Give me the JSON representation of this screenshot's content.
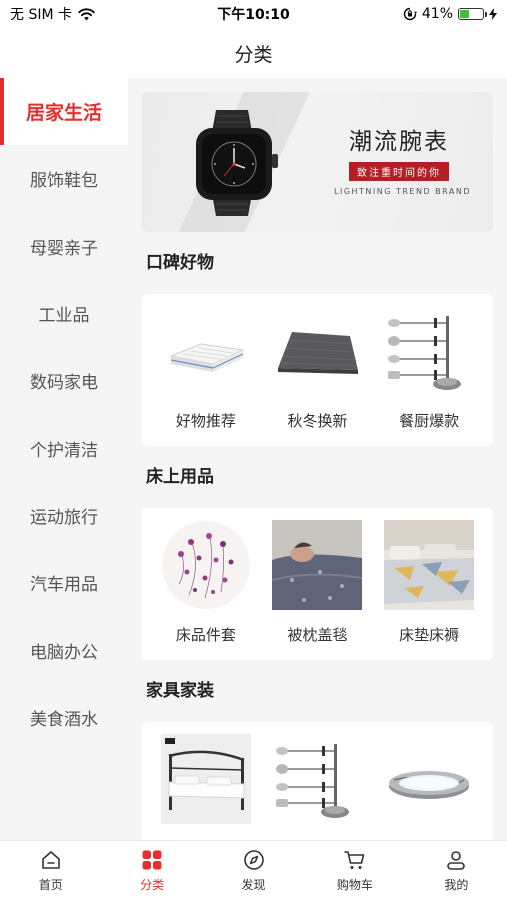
{
  "status_bar": {
    "carrier": "无 SIM 卡",
    "time": "下午10:10",
    "battery": "41%",
    "battery_level": 0.41,
    "icons": [
      "wifi-icon",
      "orientation-lock-icon",
      "battery-icon",
      "charging-icon"
    ]
  },
  "nav": {
    "title": "分类"
  },
  "sidebar": {
    "active_index": 0,
    "accent_color": "#e62e2e",
    "items": [
      {
        "label": "居家生活"
      },
      {
        "label": "服饰鞋包"
      },
      {
        "label": "母婴亲子"
      },
      {
        "label": "工业品"
      },
      {
        "label": "数码家电"
      },
      {
        "label": "个护清洁"
      },
      {
        "label": "运动旅行"
      },
      {
        "label": "汽车用品"
      },
      {
        "label": "电脑办公"
      },
      {
        "label": "美食酒水"
      }
    ]
  },
  "banner": {
    "title": "潮流腕表",
    "subtitle": "致注重时间的你",
    "english": "LIGHTNING TREND BRAND",
    "image": "smartwatch"
  },
  "sections": [
    {
      "title": "口碑好物",
      "items": [
        {
          "label": "好物推荐",
          "image": "mattress"
        },
        {
          "label": "秋冬换新",
          "image": "wood-board"
        },
        {
          "label": "餐厨爆款",
          "image": "kitchen-utensil-rack"
        }
      ]
    },
    {
      "title": "床上用品",
      "items": [
        {
          "label": "床品件套",
          "image": "floral-bedding"
        },
        {
          "label": "被枕盖毯",
          "image": "blanket"
        },
        {
          "label": "床垫床褥",
          "image": "bed-set"
        }
      ]
    },
    {
      "title": "家具家装",
      "items": [
        {
          "label": "",
          "image": "bed-frame"
        },
        {
          "label": "",
          "image": "kitchen-utensil-rack"
        },
        {
          "label": "",
          "image": "ceiling-lamp"
        }
      ]
    }
  ],
  "tabbar": {
    "active_index": 1,
    "items": [
      {
        "label": "首页",
        "icon": "home-icon"
      },
      {
        "label": "分类",
        "icon": "category-icon"
      },
      {
        "label": "发现",
        "icon": "compass-icon"
      },
      {
        "label": "购物车",
        "icon": "cart-icon"
      },
      {
        "label": "我的",
        "icon": "profile-icon"
      }
    ]
  }
}
